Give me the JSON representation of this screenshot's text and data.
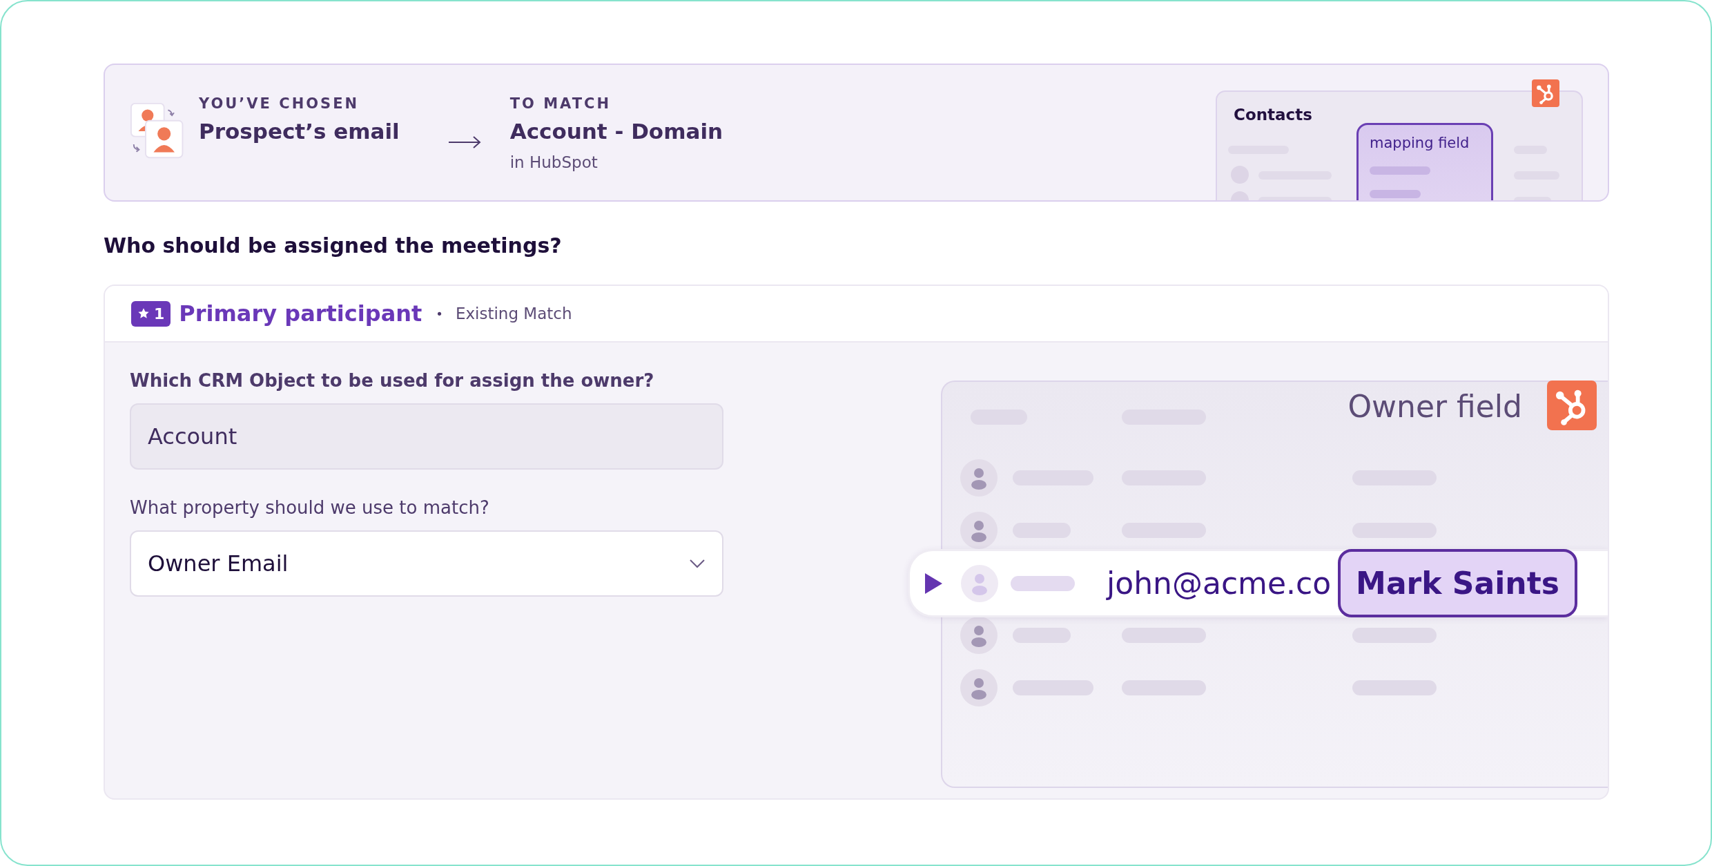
{
  "banner": {
    "source": {
      "caption": "YOU’VE CHOSEN",
      "value": "Prospect’s email"
    },
    "target": {
      "caption": "TO MATCH",
      "value": "Account - Domain",
      "note": "in HubSpot"
    },
    "preview": {
      "title": "Contacts",
      "column_label": "mapping field"
    }
  },
  "question": "Who should be assigned the meetings?",
  "participant": {
    "badge": "1",
    "title": "Primary participant",
    "separator": "•",
    "status": "Existing Match"
  },
  "form": [
    {
      "kind": "readonly",
      "label": "Which CRM Object to be used for assign the owner?",
      "value": "Account"
    },
    {
      "kind": "select",
      "label": "What property should we use to match?",
      "value": "Owner Email"
    }
  ],
  "owner_panel": {
    "title": "Owner field",
    "rows": [
      {
        "kind": "skeleton"
      },
      {
        "kind": "skeleton"
      },
      {
        "kind": "match",
        "email": "john@acme.co",
        "owner": "Mark Saints"
      },
      {
        "kind": "skeleton"
      },
      {
        "kind": "skeleton"
      }
    ]
  }
}
